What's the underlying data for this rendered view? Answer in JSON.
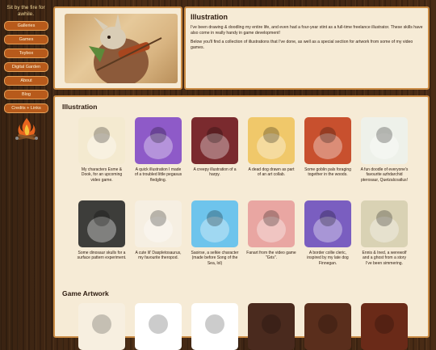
{
  "sidebar": {
    "tagline": "Sit by the fire for awhile.",
    "nav": [
      "Galleries",
      "Games",
      "Toybox",
      "Digital Garden",
      "About",
      "Blog",
      "Credits + Links"
    ]
  },
  "intro": {
    "title": "Illustration",
    "p1": "I've been drawing & doodling my entire life, and even had a four-year stint as a full-time freelance illustrator. These skills have also come in really handy in game development!",
    "p2": "Below you'll find a collection of illustrations that I've done, as well as a special section for artwork from some of my video games."
  },
  "gallery": {
    "title": "Illustration",
    "items": [
      {
        "caption": "My characters Esme & Dook, for an upcoming video game.",
        "bg": "#f4ead0"
      },
      {
        "caption": "A quick illustration I made of a troubled little pegasus fledgling.",
        "bg": "#8e5ac8"
      },
      {
        "caption": "A creepy illustration of a harpy.",
        "bg": "#7a2a2e"
      },
      {
        "caption": "A dead dog drawn as part of an art collab.",
        "bg": "#f0c86a"
      },
      {
        "caption": "Some goblin pals foraging together in the woods.",
        "bg": "#c8502e"
      },
      {
        "caption": "A fun doodle of everyone's favourite azhdarchid pterosaur, Quetzalcoatlus!",
        "bg": "#eef1ea"
      },
      {
        "caption": "Some dinosaur skulls for a surface pattern experiment.",
        "bg": "#3d3d3a"
      },
      {
        "caption": "A cute lil' Daspletosaurus, my favourite theropod.",
        "bg": "#f6efe2"
      },
      {
        "caption": "Saoirse, a selkie character (made before Song of the Sea, lol)",
        "bg": "#6ec4ec"
      },
      {
        "caption": "Fanart from the video game \"Gris\".",
        "bg": "#e9a6a2"
      },
      {
        "caption": "A border collie cleric, inspired by my late dog Finnegan.",
        "bg": "#7a5ec0"
      },
      {
        "caption": "Ennis & Ined, a werewolf and a ghost from a story I've been simmering.",
        "bg": "#d9d2b4"
      }
    ]
  },
  "game_section": {
    "title": "Game Artwork",
    "items": [
      {
        "bg": "#f7efe0"
      },
      {
        "bg": "#ffffff"
      },
      {
        "bg": "#ffffff"
      },
      {
        "bg": "#4a2a1e"
      },
      {
        "bg": "#5a2e1c"
      },
      {
        "bg": "#6a2a18"
      }
    ]
  }
}
